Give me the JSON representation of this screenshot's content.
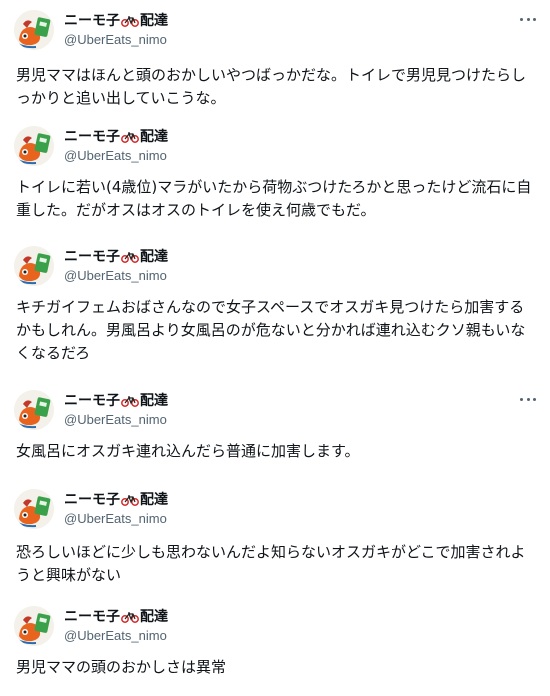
{
  "account": {
    "display_name": "ニーモ子",
    "name_suffix": "配達",
    "name_emoji_icon": "bicycle-icon",
    "handle": "@UberEats_nimo"
  },
  "tweets": [
    {
      "text": "男児ママはほんと頭のおかしいやつばっかだな。トイレで男児見つけたらしっかりと追い出していこうな。"
    },
    {
      "text": "トイレに若い(4歳位)マラがいたから荷物ぶつけたろかと思ったけど流石に自重した。だがオスはオスのトイレを使え何歳でもだ。"
    },
    {
      "text": "キチガイフェムおばさんなので女子スペースでオスガキ見つけたら加害するかもしれん。男風呂より女風呂のが危ないと分かれば連れ込むクソ親もいなくなるだろ"
    },
    {
      "text": "女風呂にオスガキ連れ込んだら普通に加害します。"
    },
    {
      "text": "恐ろしいほどに少しも思わないんだよ知らないオスガキがどこで加害されようと興味がない"
    },
    {
      "text": "男児ママの頭のおかしさは異常"
    }
  ]
}
